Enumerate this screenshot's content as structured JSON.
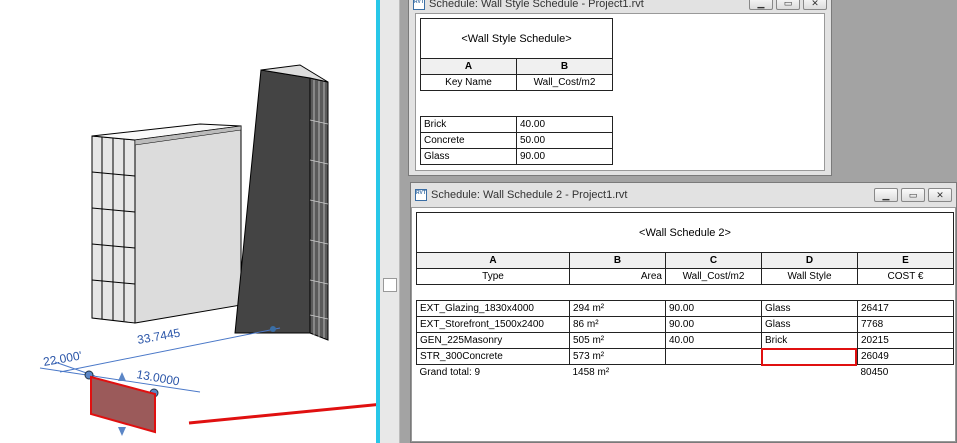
{
  "viewport": {
    "dims": {
      "horizontal": "33.7445",
      "left": "22.000'",
      "right": "13.0000"
    }
  },
  "style_window": {
    "title": "Schedule: Wall Style Schedule - Project1.rvt",
    "schedule_title": "<Wall Style Schedule>",
    "col_letters": [
      "A",
      "B"
    ],
    "col_headers": [
      "Key Name",
      "Wall_Cost/m2"
    ],
    "rows": [
      [
        "Brick",
        "40.00"
      ],
      [
        "Concrete",
        "50.00"
      ],
      [
        "Glass",
        "90.00"
      ]
    ]
  },
  "wall_window": {
    "title": "Schedule: Wall Schedule 2 - Project1.rvt",
    "schedule_title": "<Wall Schedule 2>",
    "col_letters": [
      "A",
      "B",
      "C",
      "D",
      "E"
    ],
    "col_headers": [
      "Type",
      "Area",
      "Wall_Cost/m2",
      "Wall Style",
      "COST €"
    ],
    "rows": [
      [
        "EXT_Glazing_1830x4000",
        "294 m²",
        "90.00",
        "Glass",
        "26417"
      ],
      [
        "EXT_Storefront_1500x2400",
        "86 m²",
        "90.00",
        "Glass",
        "7768"
      ],
      [
        "GEN_225Masonry",
        "505 m²",
        "40.00",
        "Brick",
        "20215"
      ],
      [
        "STR_300Concrete",
        "573 m²",
        "",
        "",
        "26049"
      ]
    ],
    "total": [
      "Grand total: 9",
      "1458 m²",
      "",
      "",
      "80450"
    ]
  },
  "window_buttons": [
    "minimize",
    "maximize",
    "close"
  ],
  "icons": [
    "rvt-file-icon",
    "minimize-icon",
    "maximize-icon",
    "close-icon"
  ],
  "colors": {
    "highlight": "#e01010",
    "divider": "#27c7e8"
  }
}
